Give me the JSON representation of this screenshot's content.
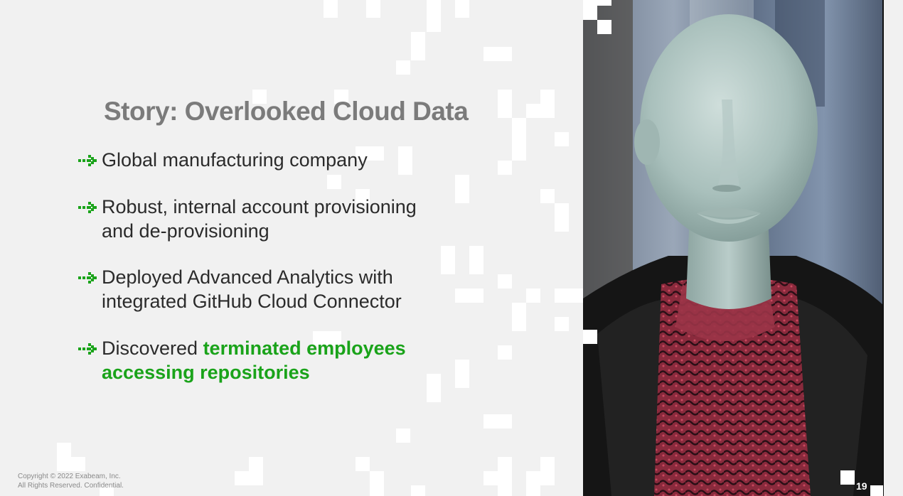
{
  "slide": {
    "title": "Story: Overlooked Cloud Data",
    "page_number": "19",
    "copyright_line1": "Copyright © 2022 Exabeam, Inc.",
    "copyright_line2": "All Rights Reserved. Confidential."
  },
  "bullets": [
    {
      "line1": "Global manufacturing company",
      "line2": ""
    },
    {
      "line1": "Robust, internal account provisioning",
      "line2": "and de-provisioning"
    },
    {
      "line1": "Deployed Advanced Analytics with",
      "line2": "integrated GitHub Cloud Connector"
    },
    {
      "line1_plain": "Discovered ",
      "line1_highlight": "terminated employees",
      "line2_highlight": "accessing repositories"
    }
  ],
  "colors": {
    "accent_green": "#1aa31a",
    "title_gray": "#7b7b7b",
    "body_text": "#2b2b2b",
    "background": "#f1f1f1"
  },
  "icons": {
    "bullet": "arrow-right-icon"
  },
  "image": {
    "subject": "mannequin-head-photo"
  }
}
